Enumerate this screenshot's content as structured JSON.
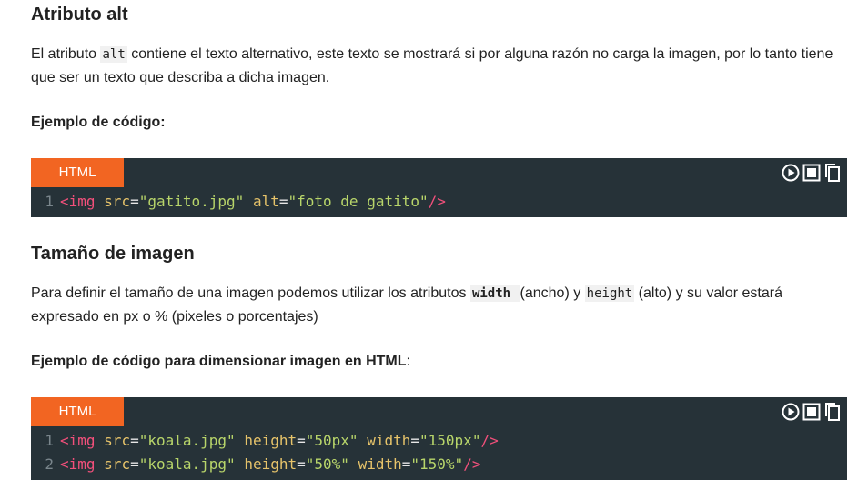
{
  "section1": {
    "heading": "Atributo alt",
    "para_before": "El atributo ",
    "para_code": "alt",
    "para_after": " contiene el texto alternativo, este texto se mostrará si por alguna razón no carga la imagen, por lo tanto tiene que ser un texto que describa a dicha imagen.",
    "example_label": "Ejemplo de código:",
    "code": {
      "lang": "HTML",
      "lines": [
        {
          "num": "1",
          "open": "<img",
          "attr1": "src",
          "val1": "\"gatito.jpg\"",
          "attr2": "alt",
          "val2": "\"foto de gatito\"",
          "close": "/>"
        }
      ]
    }
  },
  "section2": {
    "heading": "Tamaño de imagen",
    "para_before": "Para definir el tamaño de una imagen podemos utilizar los atributos ",
    "code_width": "width ",
    "para_mid": " (ancho) y ",
    "code_height": "height",
    "para_after": " (alto) y su valor estará expresado en px o % (pixeles o porcentajes)",
    "example_label": "Ejemplo de código para dimensionar imagen en HTML",
    "example_colon": ":",
    "code": {
      "lang": "HTML",
      "lines": [
        {
          "num": "1",
          "open": "<img",
          "attr1": "src",
          "val1": "\"koala.jpg\"",
          "attr2": "height",
          "val2": "\"50px\"",
          "attr3": "width",
          "val3": "\"150px\"",
          "close": "/>"
        },
        {
          "num": "2",
          "open": "<img",
          "attr1": "src",
          "val1": "\"koala.jpg\"",
          "attr2": "height",
          "val2": "\"50%\"",
          "attr3": "width",
          "val3": "\"150%\"",
          "close": "/>"
        }
      ]
    }
  },
  "toolbar": {
    "icons": [
      "play-icon",
      "stop-icon",
      "copy-icon"
    ]
  },
  "colors": {
    "code_bg": "#263238",
    "lang_tab": "#f26522",
    "tag": "#f2507b",
    "attr": "#e6c36a",
    "value": "#b8d56a",
    "line_number": "#7a868c"
  }
}
